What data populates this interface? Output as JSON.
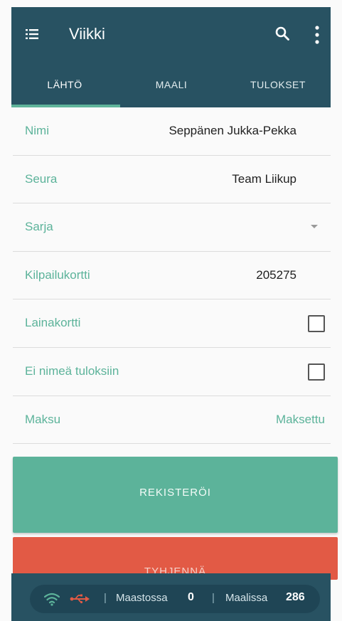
{
  "header": {
    "title": "Viikki",
    "tabs": [
      {
        "label": "LÄHTÖ",
        "active": true
      },
      {
        "label": "MAALI",
        "active": false
      },
      {
        "label": "TULOKSET",
        "active": false
      }
    ]
  },
  "form": {
    "name": {
      "label": "Nimi",
      "value": "Seppänen Jukka-Pekka"
    },
    "club": {
      "label": "Seura",
      "value": "Team Liikup"
    },
    "series": {
      "label": "Sarja",
      "value": ""
    },
    "card": {
      "label": "Kilpailukortti",
      "value": "205275"
    },
    "loan_card": {
      "label": "Lainakortti",
      "checked": false
    },
    "no_name": {
      "label": "Ei nimeä tuloksiin",
      "checked": false
    },
    "payment": {
      "label": "Maksu",
      "value": "Maksettu"
    }
  },
  "buttons": {
    "register": "REKISTERÖI",
    "clear": "TYHJENNÄ"
  },
  "status": {
    "terrain_label": "Maastossa",
    "terrain_count": "0",
    "finish_label": "Maalissa",
    "finish_count": "286",
    "separator": "|"
  },
  "colors": {
    "primary": "#285262",
    "accent": "#5cb39a",
    "danger": "#e25a45",
    "wifi": "#5cb39a",
    "usb": "#e25a45"
  },
  "icons": [
    "menu-icon",
    "search-icon",
    "more-vert-icon",
    "wifi-icon",
    "usb-icon",
    "dropdown-arrow-icon"
  ]
}
